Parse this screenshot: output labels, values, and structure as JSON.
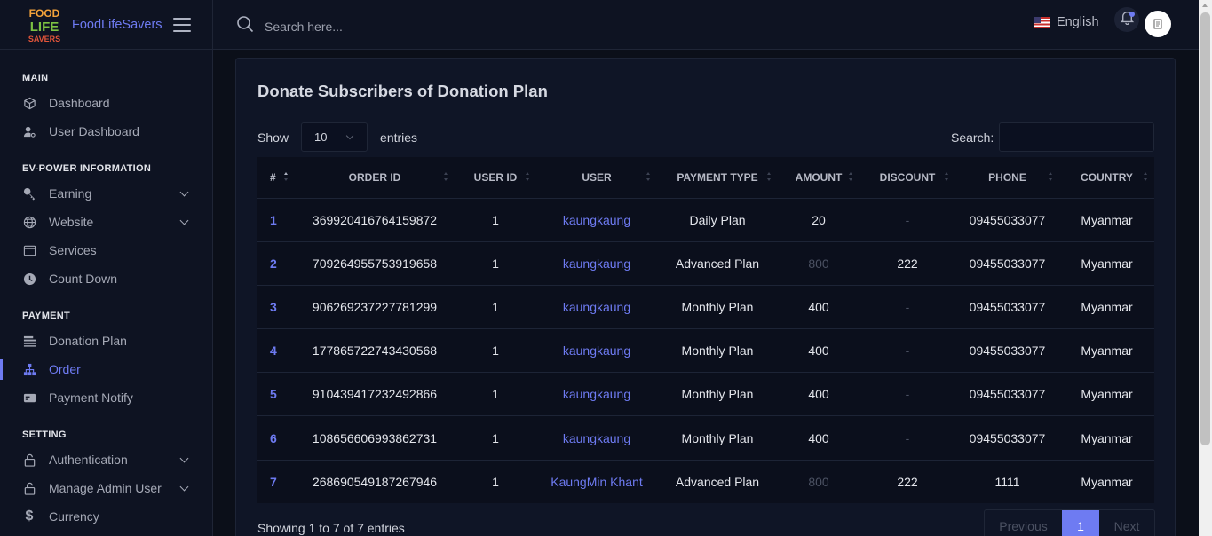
{
  "brand": {
    "logo_lines": [
      "FOOD",
      "LIFE",
      "SAVERS"
    ],
    "name": "FoodLifeSavers"
  },
  "topbar": {
    "search_placeholder": "Search here...",
    "language": "English",
    "icons": {
      "search": "search-icon",
      "flag": "us-flag-icon",
      "bell": "bell-icon",
      "menu": "hamburger-icon"
    }
  },
  "sidebar": {
    "sections": [
      {
        "title": "MAIN",
        "items": [
          {
            "label": "Dashboard",
            "icon": "cube-icon"
          },
          {
            "label": "User Dashboard",
            "icon": "user-gear-icon"
          }
        ]
      },
      {
        "title": "EV-POWER INFORMATION",
        "items": [
          {
            "label": "Earning",
            "icon": "key-icon",
            "expandable": true
          },
          {
            "label": "Website",
            "icon": "globe-icon",
            "expandable": true
          },
          {
            "label": "Services",
            "icon": "window-icon"
          },
          {
            "label": "Count Down",
            "icon": "clock-icon"
          }
        ]
      },
      {
        "title": "PAYMENT",
        "items": [
          {
            "label": "Donation Plan",
            "icon": "list-icon"
          },
          {
            "label": "Order",
            "icon": "sitemap-icon",
            "active": true
          },
          {
            "label": "Payment Notify",
            "icon": "card-icon"
          }
        ]
      },
      {
        "title": "SETTING",
        "items": [
          {
            "label": "Authentication",
            "icon": "lock-icon",
            "expandable": true
          },
          {
            "label": "Manage Admin User",
            "icon": "lock-icon",
            "expandable": true
          },
          {
            "label": "Currency",
            "icon": "dollar-icon"
          }
        ]
      }
    ]
  },
  "page": {
    "title": "Donate Subscribers of Donation Plan",
    "show_label": "Show",
    "entries_label": "entries",
    "page_length": "10",
    "search_label": "Search:",
    "info": "Showing 1 to 7 of 7 entries",
    "pagination": {
      "previous": "Previous",
      "current": "1",
      "next": "Next"
    }
  },
  "table": {
    "columns": [
      "#",
      "ORDER ID",
      "USER ID",
      "USER",
      "PAYMENT TYPE",
      "AMOUNT",
      "DISCOUNT",
      "PHONE",
      "COUNTRY"
    ],
    "rows": [
      {
        "idx": "1",
        "order_id": "369920416764159872",
        "user_id": "1",
        "user": "kaungkaung",
        "payment_type": "Daily Plan",
        "amount": "20",
        "discount": "-",
        "phone": "09455033077",
        "country": "Myanmar"
      },
      {
        "idx": "2",
        "order_id": "709264955753919658",
        "user_id": "1",
        "user": "kaungkaung",
        "payment_type": "Advanced Plan",
        "amount": "800",
        "discount": "222",
        "phone": "09455033077",
        "country": "Myanmar"
      },
      {
        "idx": "3",
        "order_id": "906269237227781299",
        "user_id": "1",
        "user": "kaungkaung",
        "payment_type": "Monthly Plan",
        "amount": "400",
        "discount": "-",
        "phone": "09455033077",
        "country": "Myanmar"
      },
      {
        "idx": "4",
        "order_id": "177865722743430568",
        "user_id": "1",
        "user": "kaungkaung",
        "payment_type": "Monthly Plan",
        "amount": "400",
        "discount": "-",
        "phone": "09455033077",
        "country": "Myanmar"
      },
      {
        "idx": "5",
        "order_id": "910439417232492866",
        "user_id": "1",
        "user": "kaungkaung",
        "payment_type": "Monthly Plan",
        "amount": "400",
        "discount": "-",
        "phone": "09455033077",
        "country": "Myanmar"
      },
      {
        "idx": "6",
        "order_id": "108656606993862731",
        "user_id": "1",
        "user": "kaungkaung",
        "payment_type": "Monthly Plan",
        "amount": "400",
        "discount": "-",
        "phone": "09455033077",
        "country": "Myanmar"
      },
      {
        "idx": "7",
        "order_id": "268690549187267946",
        "user_id": "1",
        "user": "KaungMin Khant",
        "payment_type": "Advanced Plan",
        "amount": "800",
        "discount": "222",
        "phone": "1111",
        "country": "Myanmar"
      }
    ]
  },
  "colors": {
    "accent": "#6e7bf2",
    "background": "#0b0f19",
    "panel": "#0e1322"
  }
}
